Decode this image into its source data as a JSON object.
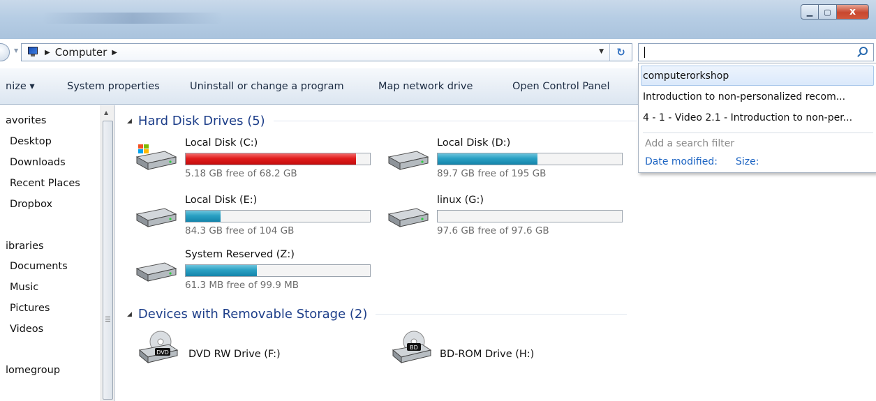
{
  "window": {
    "controls": {
      "minimize_icon": "minimize-icon",
      "maximize_icon": "maximize-icon",
      "close_icon": "close-icon",
      "close_label": "x"
    }
  },
  "address_bar": {
    "crumb": "Computer",
    "icon": "computer-icon",
    "refresh_icon": "refresh-icon"
  },
  "search": {
    "value": "",
    "icon": "search-icon"
  },
  "search_suggestions": {
    "items": [
      "computerorkshop",
      "Introduction to non-personalized recom...",
      "4 - 1 - Video 2.1 - Introduction to non-per..."
    ],
    "filter_title": "Add a search filter",
    "filters": [
      "Date modified:",
      "Size:"
    ]
  },
  "toolbar": {
    "organize": "nize ▾",
    "system_properties": "System properties",
    "uninstall": "Uninstall or change a program",
    "map_drive": "Map network drive",
    "control_panel": "Open Control Panel"
  },
  "navigation": {
    "favorites_header": "avorites",
    "favorites": [
      "Desktop",
      "Downloads",
      "Recent Places",
      "Dropbox"
    ],
    "libraries_header": "ibraries",
    "libraries": [
      "Documents",
      "Music",
      "Pictures",
      "Videos"
    ],
    "homegroup": "lomegroup"
  },
  "groups": {
    "hard_disks": {
      "title": "Hard Disk Drives (5)",
      "drives": [
        {
          "name": "Local Disk (C:)",
          "free_text": "5.18 GB free of 68.2 GB",
          "used_fraction": 0.924,
          "bar_color": "#e01d1d",
          "icon": "windows-drive-icon"
        },
        {
          "name": "Local Disk (D:)",
          "free_text": "89.7 GB free of 195 GB",
          "used_fraction": 0.54,
          "bar_color": "#2aa0c3",
          "icon": "hard-drive-icon"
        },
        {
          "name": "Local Disk (E:)",
          "free_text": "84.3 GB free of 104 GB",
          "used_fraction": 0.19,
          "bar_color": "#2aa0c3",
          "icon": "hard-drive-icon"
        },
        {
          "name": "linux (G:)",
          "free_text": "97.6 GB free of 97.6 GB",
          "used_fraction": 0.0,
          "bar_color": "#2aa0c3",
          "icon": "hard-drive-icon"
        },
        {
          "name": "System Reserved (Z:)",
          "free_text": "61.3 MB free of 99.9 MB",
          "used_fraction": 0.386,
          "bar_color": "#2aa0c3",
          "icon": "hard-drive-icon"
        }
      ]
    },
    "removable": {
      "title": "Devices with Removable Storage (2)",
      "devices": [
        {
          "name": "DVD RW Drive (F:)",
          "badge": "DVD",
          "icon": "dvd-drive-icon"
        },
        {
          "name": "BD-ROM Drive (H:)",
          "badge": "BD",
          "icon": "bd-drive-icon"
        }
      ]
    }
  }
}
